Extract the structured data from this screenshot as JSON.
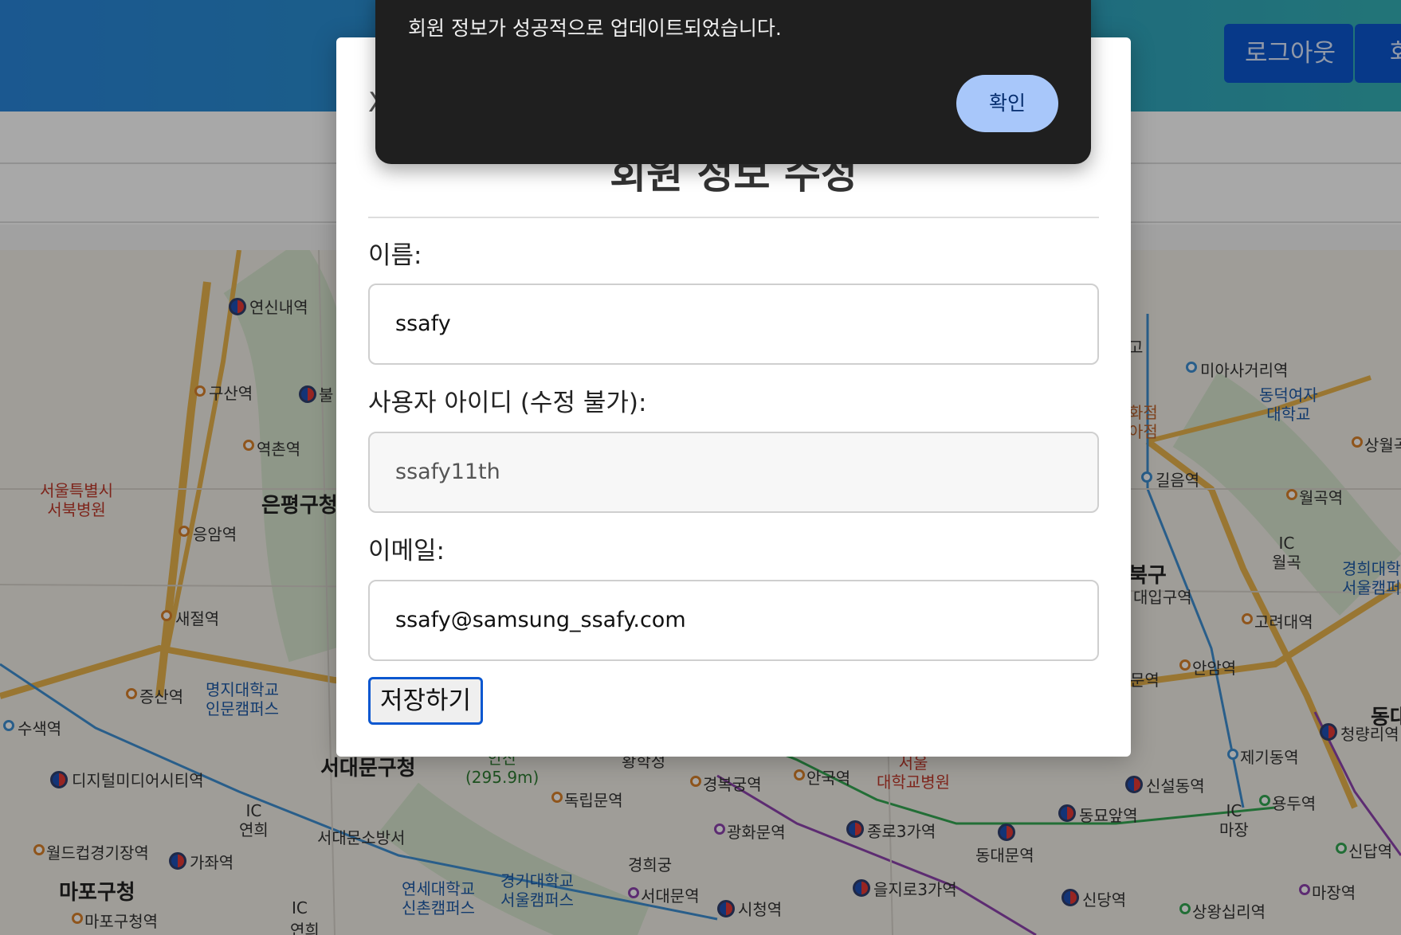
{
  "header": {
    "logout_label": "로그아웃",
    "member_label": "회원"
  },
  "map": {
    "labels": {
      "yeonsinnae": "연신내역",
      "gusan": "구산역",
      "bul": "불",
      "yeokchon": "역촌역",
      "seobuk_hospital": "서울특별시\n서북병원",
      "eunpyeong_gu": "은평구청",
      "eungam": "응암역",
      "saejeol": "새절역",
      "jeungsan": "증산역",
      "myongji": "명지대학교\n인문캠퍼스",
      "susaek": "수색역",
      "dmc": "디지털미디어시티역",
      "seodaemun_gu": "서대문구청",
      "ansan": "안산\n(295.9m)",
      "dongnimmun": "독립문역",
      "gyeongbokgung": "경복궁역",
      "anguk": "안국역",
      "snu_hospital": "서울\n대학교병원",
      "sinseoldong": "신설동역",
      "yongdu": "용두역",
      "ic_yeonhui": "IC\n연희",
      "seodaemun_fire": "서대문소방서",
      "gwanghwamun": "광화문역",
      "jongno3ga": "종로3가역",
      "dongmyo": "동묘앞역",
      "dongdaemun": "동대문역",
      "ic_majang": "IC\n마장",
      "sindap": "신답역",
      "worldcup": "월드컵경기장역",
      "gajwa": "가좌역",
      "gyeonghuigung": "경희궁",
      "mapo_gu": "마포구청",
      "yonsei": "연세대학교\n신촌캠퍼스",
      "kyonggi": "경기대학교\n서울캠퍼스",
      "seodaemun_st": "서대문역",
      "cityhall": "시청역",
      "euljiro3ga": "을지로3가역",
      "sindang": "신당역",
      "sangwangsimni": "상왕십리역",
      "majang": "마장역",
      "mapo_gu_st": "마포구청역",
      "miasageori": "미아사거리역",
      "dongduk": "동덕여자\n대학교",
      "sangwolgok": "상월곡",
      "gireum": "길음역",
      "wolgok": "월곡역",
      "ic_wolgok": "IC\n월곡",
      "kyunghee": "경희대학\n서울캠퍼",
      "seongbuk": "북구",
      "daeipgu": "대입구역",
      "korea_univ": "고려대역",
      "anam": "안암역",
      "munyeok": "문역",
      "cheongnyangni": "청량리역",
      "jegi": "제기동역",
      "dong": "동대",
      "shopping": "화점\n아점",
      "go": "고",
      "hwanghak": "황학정",
      "yeonhui2": "연희",
      "ic_yeonhui2": "IC"
    }
  },
  "modal": {
    "close_label": "X",
    "title": "회원 정보 수정",
    "name_label": "이름:",
    "name_value": "ssafy",
    "userid_label": "사용자 아이디 (수정 불가):",
    "userid_value": "ssafy11th",
    "email_label": "이메일:",
    "email_value": "ssafy@samsung_ssafy.com",
    "save_label": "저장하기"
  },
  "alert": {
    "message": "회원 정보가 성공적으로 업데이트되었습니다.",
    "ok_label": "확인"
  },
  "colors": {
    "header_start": "#2a86db",
    "header_end": "#35b1b6",
    "button_blue": "#0b57d0",
    "alert_bg": "#1f1f1f",
    "alert_button": "#a8c7fa"
  }
}
